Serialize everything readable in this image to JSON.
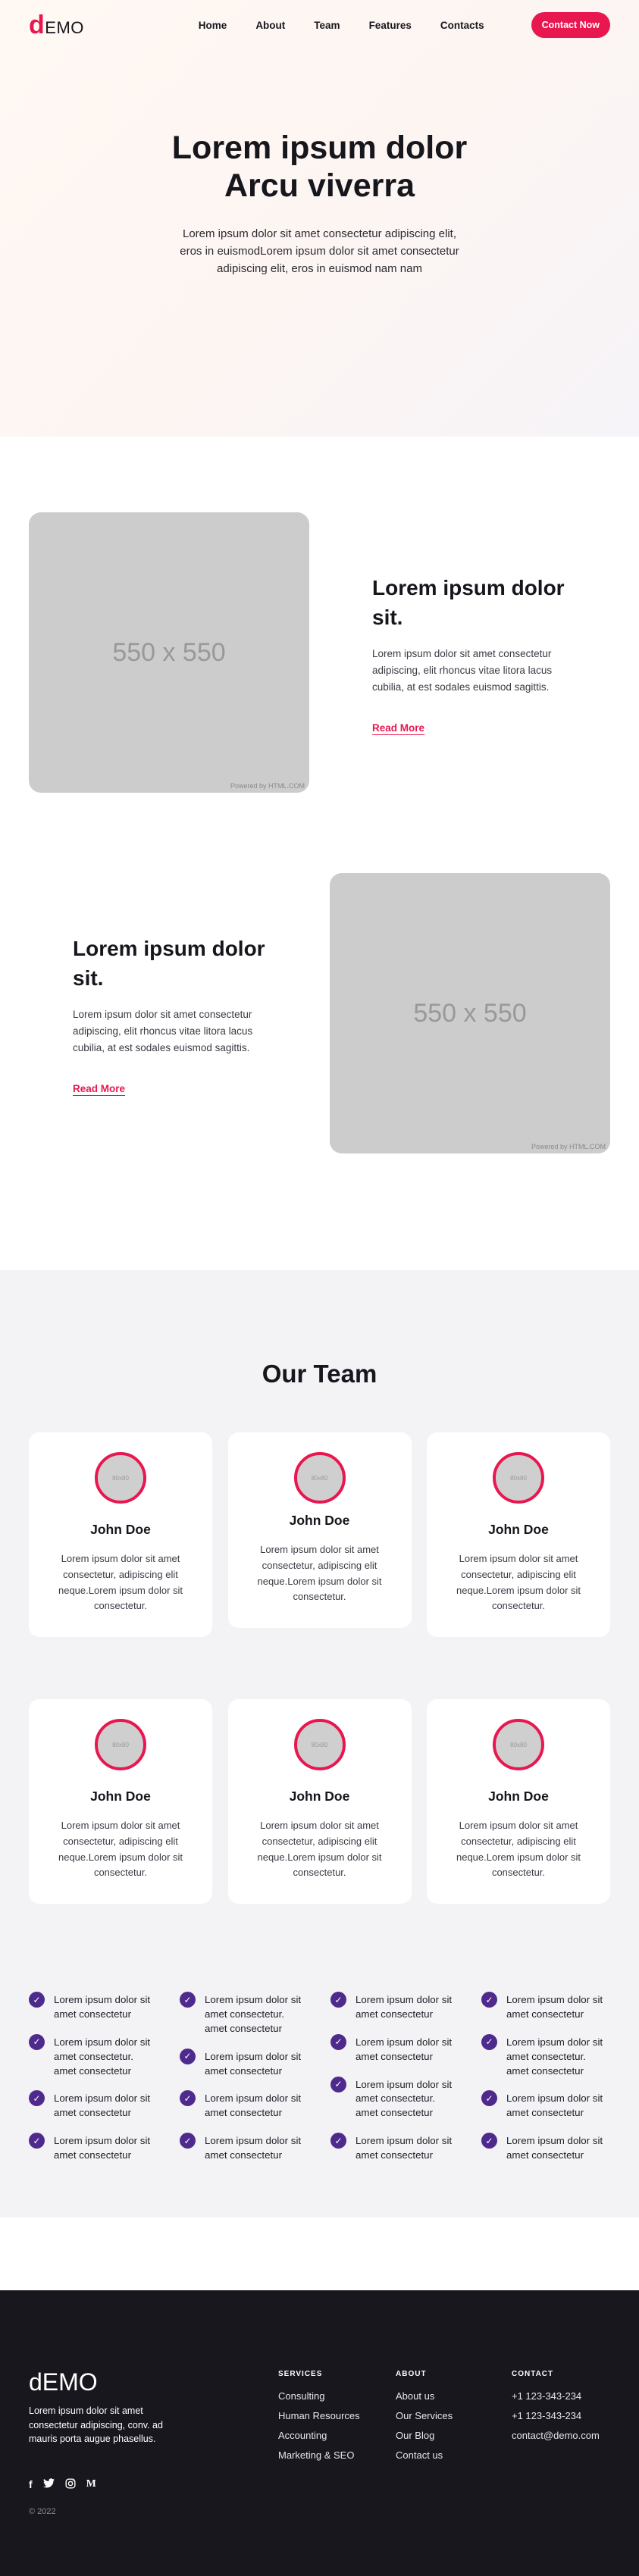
{
  "header": {
    "logo_d": "d",
    "logo_rest": "EMO",
    "nav": [
      "Home",
      "About",
      "Team",
      "Features",
      "Contacts"
    ],
    "cta": "Contact Now"
  },
  "hero": {
    "title": "Lorem ipsum dolor Arcu viverra",
    "subtitle": "Lorem ipsum dolor sit amet consectetur adipiscing elit, eros in euismodLorem ipsum dolor sit amet consectetur adipiscing elit, eros in euismod nam nam"
  },
  "features": [
    {
      "image_label": "550 x 550",
      "image_credit": "Powered by HTML.COM",
      "title": "Lorem ipsum dolor sit.",
      "body": "Lorem ipsum dolor sit amet consectetur adipiscing, elit rhoncus vitae litora lacus cubilia, at est sodales euismod sagittis.",
      "link": "Read More"
    },
    {
      "image_label": "550 x 550",
      "image_credit": "Powered by HTML.COM",
      "title": "Lorem ipsum dolor sit.",
      "body": "Lorem ipsum dolor sit amet consectetur adipiscing, elit rhoncus vitae litora lacus cubilia, at est sodales euismod sagittis.",
      "link": "Read More"
    }
  ],
  "team": {
    "title": "Our Team",
    "avatar_label": "80x80",
    "members": [
      {
        "name": "John Doe",
        "desc": "Lorem ipsum dolor sit amet consectetur, adipiscing elit neque.Lorem ipsum dolor sit consectetur."
      },
      {
        "name": "John Doe",
        "desc": "Lorem ipsum dolor sit amet consectetur, adipiscing elit neque.Lorem ipsum dolor sit consectetur."
      },
      {
        "name": "John Doe",
        "desc": "Lorem ipsum dolor sit amet consectetur, adipiscing elit neque.Lorem ipsum dolor sit consectetur."
      },
      {
        "name": "John Doe",
        "desc": "Lorem ipsum dolor sit amet consectetur, adipiscing elit neque.Lorem ipsum dolor sit consectetur."
      },
      {
        "name": "John Doe",
        "desc": "Lorem ipsum dolor sit amet consectetur, adipiscing elit neque.Lorem ipsum dolor sit consectetur."
      },
      {
        "name": "John Doe",
        "desc": "Lorem ipsum dolor sit amet consectetur, adipiscing elit neque.Lorem ipsum dolor sit consectetur."
      }
    ]
  },
  "checklist": {
    "icon": "check-icon",
    "columns": [
      [
        "Lorem ipsum dolor sit amet consectetur",
        "Lorem ipsum dolor sit amet consectetur. amet consectetur",
        "Lorem ipsum dolor sit amet consectetur",
        "Lorem ipsum dolor sit amet consectetur"
      ],
      [
        "Lorem ipsum dolor sit amet consectetur. amet consectetur",
        "Lorem ipsum dolor sit amet consectetur",
        "Lorem ipsum dolor sit amet consectetur",
        "Lorem ipsum dolor sit amet consectetur"
      ],
      [
        "Lorem ipsum dolor sit amet consectetur",
        "Lorem ipsum dolor sit amet consectetur",
        "Lorem ipsum dolor sit amet consectetur. amet consectetur",
        "Lorem ipsum dolor sit amet consectetur"
      ],
      [
        "Lorem ipsum dolor sit amet consectetur",
        "Lorem ipsum dolor sit amet consectetur. amet consectetur",
        "Lorem ipsum dolor sit amet consectetur",
        "Lorem ipsum dolor sit amet consectetur"
      ]
    ]
  },
  "footer": {
    "brand": "dEMO",
    "desc": "Lorem ipsum dolor sit amet consectetur adipiscing, conv. ad mauris porta augue phasellus.",
    "social": [
      "facebook-icon",
      "twitter-icon",
      "instagram-icon",
      "medium-icon"
    ],
    "social_glyphs": [
      "f",
      "🐦",
      "◎",
      "M"
    ],
    "copyright": "© 2022",
    "services": {
      "title": "SERVICES",
      "links": [
        "Consulting",
        "Human Resources",
        "Accounting",
        "Marketing & SEO"
      ]
    },
    "about": {
      "title": "ABOUT",
      "links": [
        "About us",
        "Our Services",
        "Our Blog",
        "Contact us"
      ]
    },
    "contact": {
      "title": "CONTACT",
      "links": [
        "+1 123-343-234",
        "+1 123-343-234",
        "contact@demo.com"
      ]
    }
  },
  "colors": {
    "accent": "#e8174f",
    "check": "#4f2a8d",
    "footer_bg": "#17171d",
    "team_bg": "#f3f3f6"
  }
}
